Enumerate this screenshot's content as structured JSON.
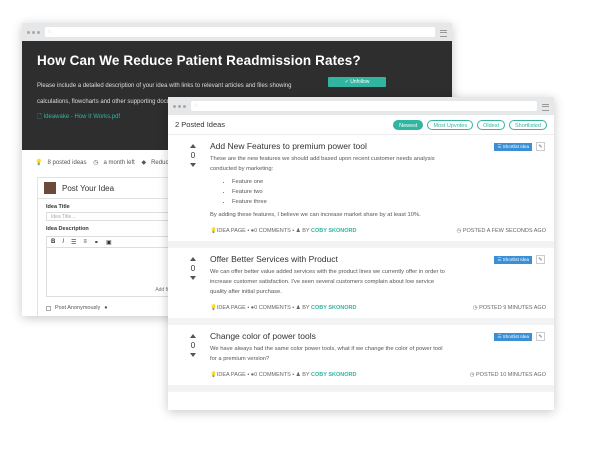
{
  "back": {
    "url": "",
    "title": "How Can We Reduce Patient Readmission Rates?",
    "unfollow": "✓ Unfollow",
    "description": "Please include a detailed description of your idea with links to relevant articles and files showing calculations, flowcharts and other supporting documentation.",
    "file": "Ideawake - How It Works.pdf",
    "meta": [
      "8 posted ideas",
      "a month left",
      "Reduce Costs"
    ],
    "post_title": "Post Your Idea",
    "idea_title_label": "Idea Title",
    "idea_title_placeholder": "Idea Title...",
    "idea_desc_label": "Idea Description",
    "add_files": "Add files or im",
    "anonymous": "Post Anonymously"
  },
  "front": {
    "count": "2 Posted Ideas",
    "filters": [
      "Newest",
      "Most Upvotes",
      "Oldest",
      "Shortlisted"
    ],
    "shortlist": "Shortlist Idea",
    "ideas": [
      {
        "votes": "0",
        "title": "Add New Features to premium power tool",
        "desc": "These are the new features we should add based upon recent customer needs analysis conducted by marketing:",
        "bullets": [
          "Feature one",
          "Feature two",
          "Feature three"
        ],
        "desc2": "By adding these features, I believe we can increase market share by at least 10%.",
        "page": "IDEA PAGE",
        "comments": "0 COMMENTS",
        "by": "COBY SKONORD",
        "posted": "POSTED A FEW SECONDS AGO"
      },
      {
        "votes": "0",
        "title": "Offer Better Services with Product",
        "desc": "We can offer better value added services with the product lines we currently offer in order to increase customer satisfaction. I've seen several customers complain about low service quality after initial purchase.",
        "page": "IDEA PAGE",
        "comments": "0 COMMENTS",
        "by": "COBY SKONORD",
        "posted": "POSTED 9 MINUTES AGO"
      },
      {
        "votes": "0",
        "title": "Change color of power tools",
        "desc": "We have always had the same color power tools, what if we change the color of power tool for a premium version?",
        "page": "IDEA PAGE",
        "comments": "0 COMMENTS",
        "by": "COBY SKONORD",
        "posted": "POSTED 10 MINUTES AGO"
      }
    ]
  }
}
